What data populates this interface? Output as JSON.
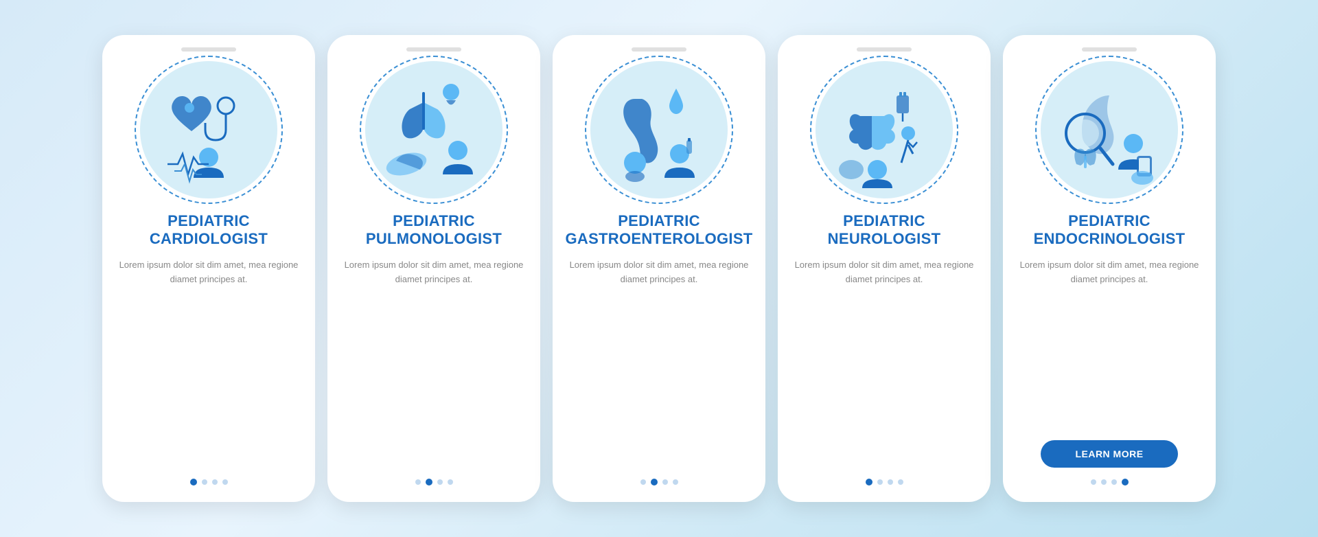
{
  "cards": [
    {
      "id": "cardiologist",
      "title": "PEDIATRIC\nCARDIOLOGIST",
      "description": "Lorem ipsum dolor sit dim amet, mea regione diamet principes at.",
      "dots": [
        0,
        1,
        2,
        3
      ],
      "active_dot": 0,
      "show_button": false,
      "button_label": ""
    },
    {
      "id": "pulmonologist",
      "title": "PEDIATRIC\nPULMONOLOGIST",
      "description": "Lorem ipsum dolor sit dim amet, mea regione diamet principes at.",
      "dots": [
        0,
        1,
        2,
        3
      ],
      "active_dot": 1,
      "show_button": false,
      "button_label": ""
    },
    {
      "id": "gastroenterologist",
      "title": "PEDIATRIC\nGASTROENTEROLOGIST",
      "description": "Lorem ipsum dolor sit dim amet, mea regione diamet principes at.",
      "dots": [
        0,
        1,
        2,
        3
      ],
      "active_dot": 1,
      "show_button": false,
      "button_label": ""
    },
    {
      "id": "neurologist",
      "title": "PEDIATRIC\nNEUROLOGIST",
      "description": "Lorem ipsum dolor sit dim amet, mea regione diamet principes at.",
      "dots": [
        0,
        1,
        2,
        3
      ],
      "active_dot": 0,
      "show_button": false,
      "button_label": ""
    },
    {
      "id": "endocrinologist",
      "title": "PEDIATRIC\nENDOCRINOLOGIST",
      "description": "Lorem ipsum dolor sit dim amet, mea regione diamet principes at.",
      "dots": [
        0,
        1,
        2,
        3
      ],
      "active_dot": 3,
      "show_button": true,
      "button_label": "LEARN MORE"
    }
  ]
}
